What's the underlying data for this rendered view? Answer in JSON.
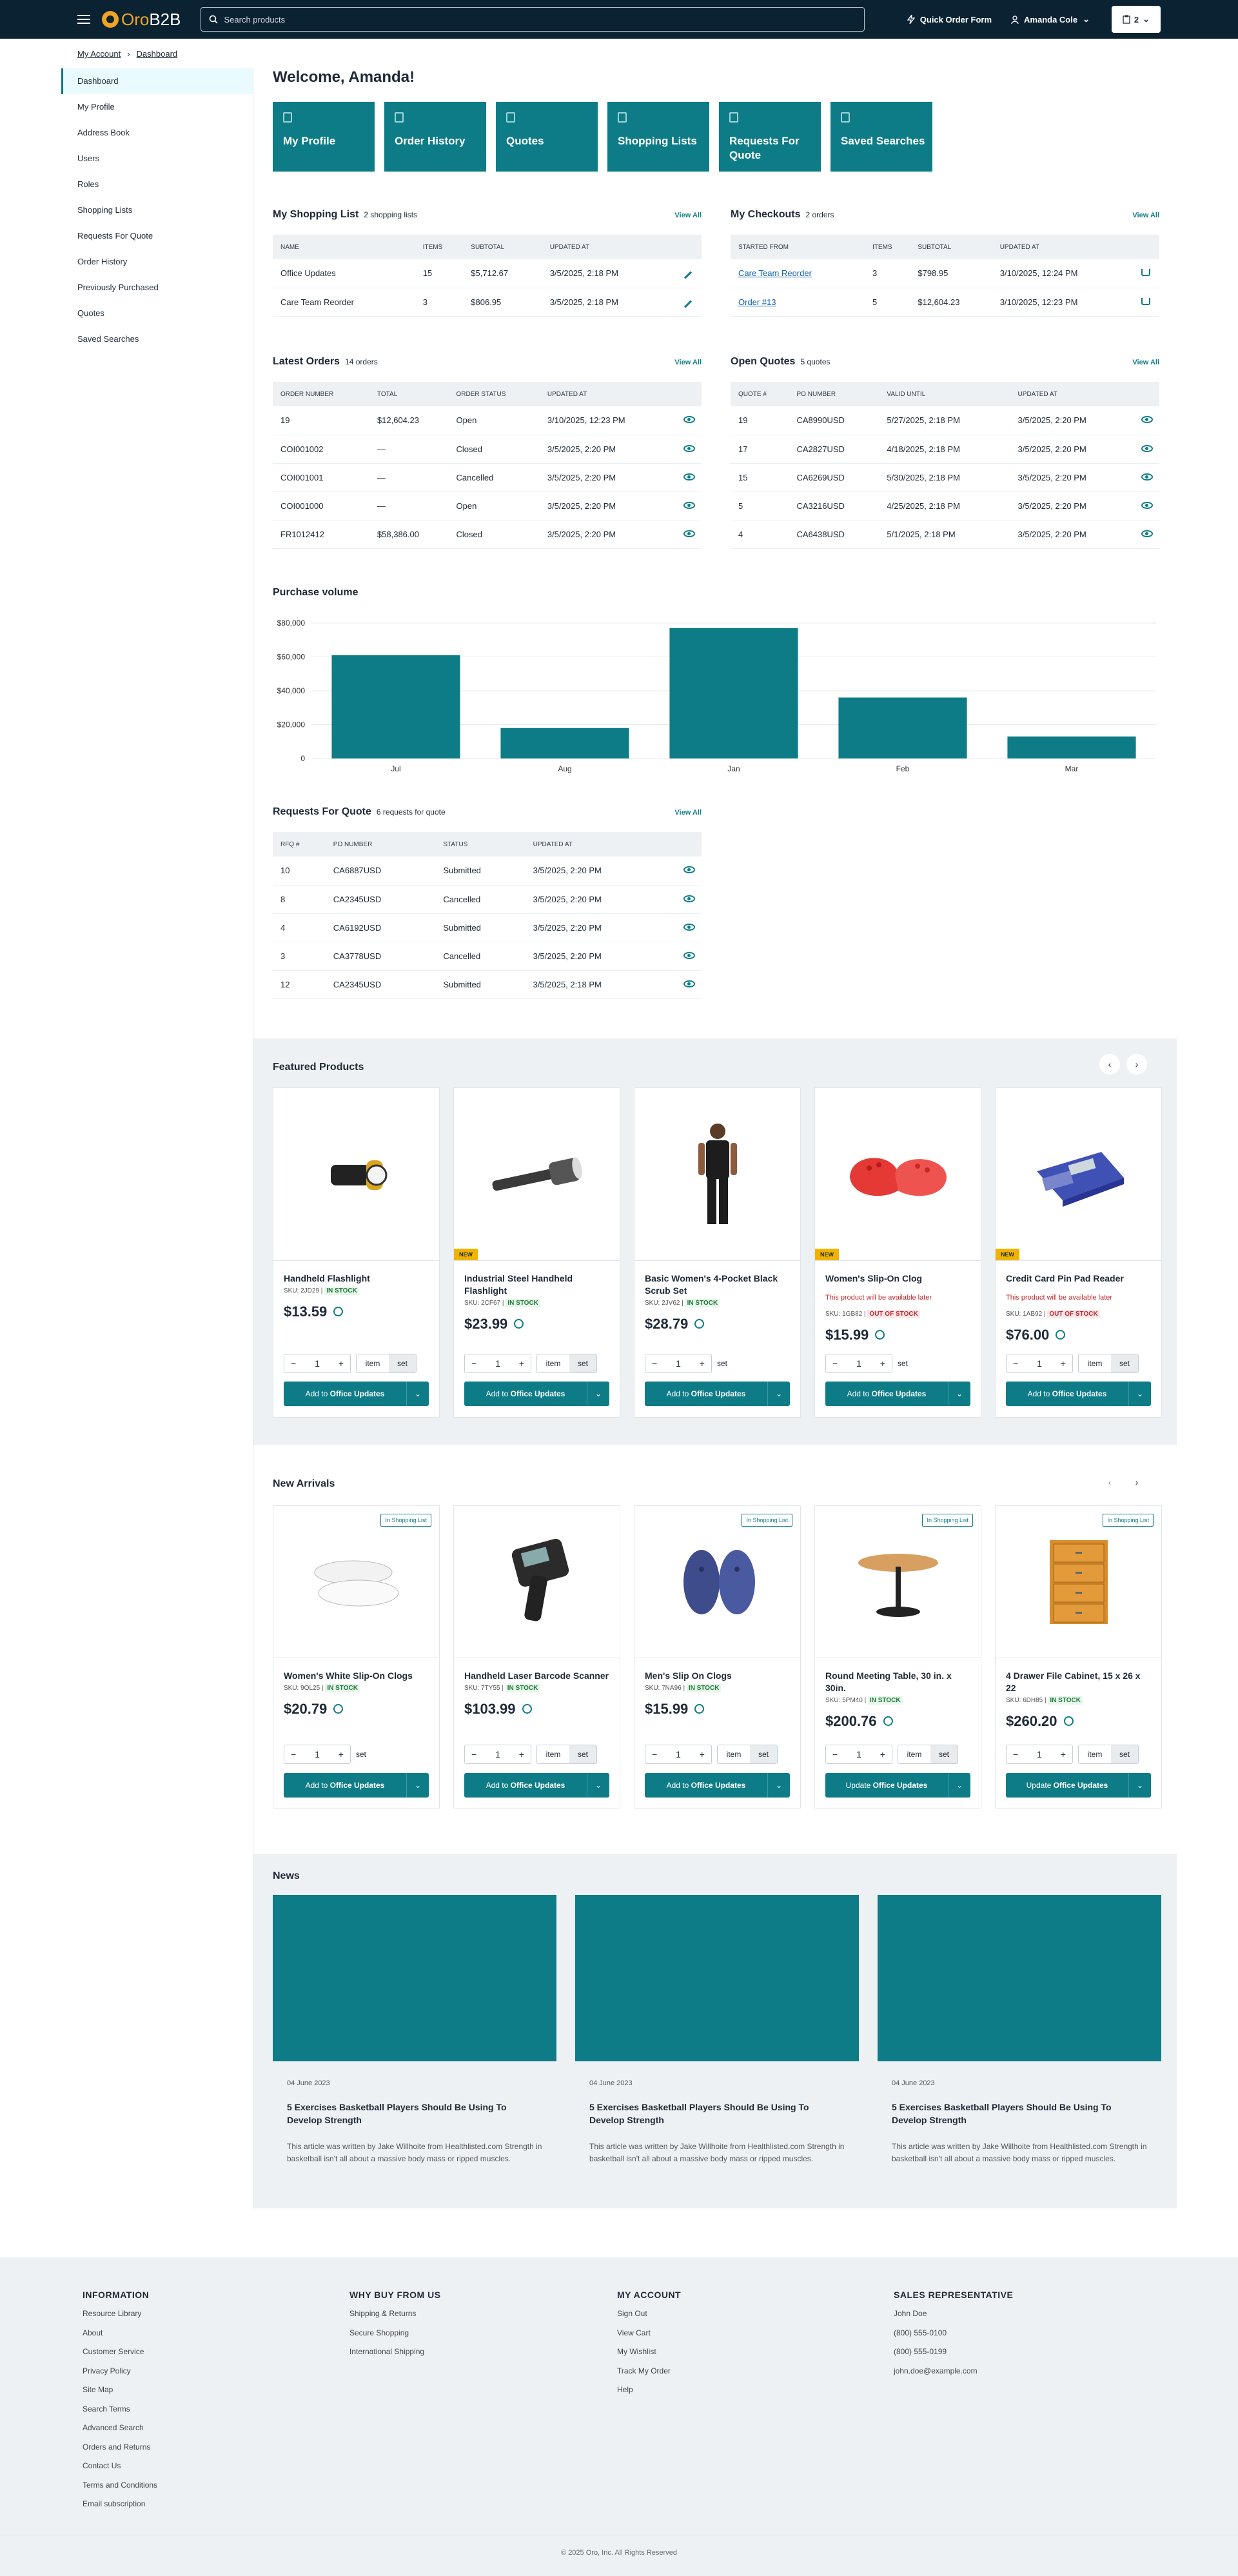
{
  "header": {
    "logo_oro": "Oro",
    "logo_b2b": "B2B",
    "search_placeholder": "Search products",
    "quick_order": "Quick Order Form",
    "user": "Amanda Cole",
    "cart_count": "2"
  },
  "breadcrumb": [
    "My Account",
    "Dashboard"
  ],
  "sidebar": {
    "items": [
      "Dashboard",
      "My Profile",
      "Address Book",
      "Users",
      "Roles",
      "Shopping Lists",
      "Requests For Quote",
      "Order History",
      "Previously Purchased",
      "Quotes",
      "Saved Searches"
    ]
  },
  "welcome": "Welcome, Amanda!",
  "tiles": [
    "My Profile",
    "Order History",
    "Quotes",
    "Shopping Lists",
    "Requests For Quote",
    "Saved Searches"
  ],
  "view_all": "View All",
  "shopping_list": {
    "title": "My Shopping List",
    "count": "2 shopping lists",
    "headers": [
      "NAME",
      "ITEMS",
      "SUBTOTAL",
      "UPDATED AT"
    ],
    "rows": [
      [
        "Office Updates",
        "15",
        "$5,712.67",
        "3/5/2025, 2:18 PM"
      ],
      [
        "Care Team Reorder",
        "3",
        "$806.95",
        "3/5/2025, 2:18 PM"
      ]
    ]
  },
  "checkouts": {
    "title": "My Checkouts",
    "count": "2 orders",
    "headers": [
      "STARTED FROM",
      "ITEMS",
      "SUBTOTAL",
      "UPDATED AT"
    ],
    "rows": [
      [
        "Care Team Reorder",
        "3",
        "$798.95",
        "3/10/2025, 12:24 PM"
      ],
      [
        "Order #13",
        "5",
        "$12,604.23",
        "3/10/2025, 12:23 PM"
      ]
    ]
  },
  "orders": {
    "title": "Latest Orders",
    "count": "14 orders",
    "headers": [
      "ORDER NUMBER",
      "TOTAL",
      "ORDER STATUS",
      "UPDATED AT"
    ],
    "rows": [
      [
        "19",
        "$12,604.23",
        "Open",
        "3/10/2025, 12:23 PM"
      ],
      [
        "COI001002",
        "—",
        "Closed",
        "3/5/2025, 2:20 PM"
      ],
      [
        "COI001001",
        "—",
        "Cancelled",
        "3/5/2025, 2:20 PM"
      ],
      [
        "COI001000",
        "—",
        "Open",
        "3/5/2025, 2:20 PM"
      ],
      [
        "FR1012412",
        "$58,386.00",
        "Closed",
        "3/5/2025, 2:20 PM"
      ]
    ]
  },
  "quotes": {
    "title": "Open Quotes",
    "count": "5 quotes",
    "headers": [
      "QUOTE #",
      "PO NUMBER",
      "VALID UNTIL",
      "UPDATED AT"
    ],
    "rows": [
      [
        "19",
        "CA8990USD",
        "5/27/2025, 2:18 PM",
        "3/5/2025, 2:20 PM"
      ],
      [
        "17",
        "CA2827USD",
        "4/18/2025, 2:18 PM",
        "3/5/2025, 2:20 PM"
      ],
      [
        "15",
        "CA6269USD",
        "5/30/2025, 2:18 PM",
        "3/5/2025, 2:20 PM"
      ],
      [
        "5",
        "CA3216USD",
        "4/25/2025, 2:18 PM",
        "3/5/2025, 2:20 PM"
      ],
      [
        "4",
        "CA6438USD",
        "5/1/2025, 2:18 PM",
        "3/5/2025, 2:20 PM"
      ]
    ]
  },
  "chart_data": {
    "type": "bar",
    "title": "Purchase volume",
    "categories": [
      "Jul",
      "Aug",
      "Jan",
      "Feb",
      "Mar"
    ],
    "values": [
      61000,
      18000,
      77000,
      36000,
      13000
    ],
    "ylim": [
      0,
      80000
    ],
    "yticks": [
      "$80,000",
      "$60,000",
      "$40,000",
      "$20,000",
      "0"
    ],
    "color": "#0e7c86",
    "grid": true
  },
  "rfq": {
    "title": "Requests For Quote",
    "count": "6 requests for quote",
    "headers": [
      "RFQ #",
      "PO NUMBER",
      "STATUS",
      "UPDATED AT"
    ],
    "rows": [
      [
        "10",
        "CA6887USD",
        "Submitted",
        "3/5/2025, 2:20 PM"
      ],
      [
        "8",
        "CA2345USD",
        "Cancelled",
        "3/5/2025, 2:20 PM"
      ],
      [
        "4",
        "CA6192USD",
        "Submitted",
        "3/5/2025, 2:20 PM"
      ],
      [
        "3",
        "CA3778USD",
        "Cancelled",
        "3/5/2025, 2:20 PM"
      ],
      [
        "12",
        "CA2345USD",
        "Submitted",
        "3/5/2025, 2:18 PM"
      ]
    ]
  },
  "featured": {
    "title": "Featured Products",
    "products": [
      {
        "name": "Handheld Flashlight",
        "sku": "SKU: 2JD29 |",
        "stock": "IN STOCK",
        "price": "$13.59",
        "new": "",
        "avail": "",
        "unit": "item",
        "set": "set",
        "btn_prefix": "Add to",
        "btn_list": "Office Updates"
      },
      {
        "name": "Industrial Steel Handheld Flashlight",
        "sku": "SKU: 2CF67 |",
        "stock": "IN STOCK",
        "price": "$23.99",
        "new": "NEW",
        "avail": "",
        "unit": "item",
        "set": "set",
        "btn_prefix": "Add to",
        "btn_list": "Office Updates"
      },
      {
        "name": "Basic Women's 4-Pocket Black Scrub Set",
        "sku": "SKU: 2JV62 |",
        "stock": "IN STOCK",
        "price": "$28.79",
        "new": "",
        "avail": "",
        "unit": "",
        "set": "set",
        "btn_prefix": "Add to",
        "btn_list": "Office Updates"
      },
      {
        "name": "Women's Slip-On Clog",
        "sku": "SKU: 1GB82 |",
        "stock": "OUT OF STOCK",
        "price": "$15.99",
        "new": "NEW",
        "avail": "This product will be available later",
        "unit": "",
        "set": "set",
        "btn_prefix": "Add to",
        "btn_list": "Office Updates"
      },
      {
        "name": "Credit Card Pin Pad Reader",
        "sku": "SKU: 1AB92 |",
        "stock": "OUT OF STOCK",
        "price": "$76.00",
        "new": "NEW",
        "avail": "This product will be available later",
        "unit": "item",
        "set": "set",
        "btn_prefix": "Add to",
        "btn_list": "Office Updates"
      }
    ]
  },
  "arrivals": {
    "title": "New Arrivals",
    "in_list": "In Shopping List",
    "products": [
      {
        "name": "Women's White Slip-On Clogs",
        "sku": "SKU: 9OL25 |",
        "stock": "IN STOCK",
        "price": "$20.79",
        "unit": "",
        "set": "set",
        "btn_prefix": "Add to",
        "btn_list": "Office Updates"
      },
      {
        "name": "Handheld Laser Barcode Scanner",
        "sku": "SKU: 7TY55 |",
        "stock": "IN STOCK",
        "price": "$103.99",
        "unit": "item",
        "set": "set",
        "btn_prefix": "Add to",
        "btn_list": "Office Updates"
      },
      {
        "name": "Men's Slip On Clogs",
        "sku": "SKU: 7NA96 |",
        "stock": "IN STOCK",
        "price": "$15.99",
        "unit": "item",
        "set": "set",
        "btn_prefix": "Add to",
        "btn_list": "Office Updates"
      },
      {
        "name": "Round Meeting Table, 30 in. x 30in.",
        "sku": "SKU: 5PM40 |",
        "stock": "IN STOCK",
        "price": "$200.76",
        "unit": "item",
        "set": "set",
        "btn_prefix": "Update",
        "btn_list": "Office Updates"
      },
      {
        "name": "4 Drawer File Cabinet, 15 x 26 x 22",
        "sku": "SKU: 6DH85 |",
        "stock": "IN STOCK",
        "price": "$260.20",
        "unit": "item",
        "set": "set",
        "btn_prefix": "Update",
        "btn_list": "Office Updates"
      }
    ]
  },
  "news": {
    "title": "News",
    "items": [
      {
        "date": "04 June 2023",
        "title": "5 Exercises Basketball Players Should Be Using To Develop Strength",
        "desc": "This article was written by Jake Willhoite from Healthlisted.com Strength in basketball isn't all about a massive body mass or ripped muscles."
      },
      {
        "date": "04 June 2023",
        "title": "5 Exercises Basketball Players Should Be Using To Develop Strength",
        "desc": "This article was written by Jake Willhoite from Healthlisted.com Strength in basketball isn't all about a massive body mass or ripped muscles."
      },
      {
        "date": "04 June 2023",
        "title": "5 Exercises Basketball Players Should Be Using To Develop Strength",
        "desc": "This article was written by Jake Willhoite from Healthlisted.com Strength in basketball isn't all about a massive body mass or ripped muscles."
      }
    ]
  },
  "footer": {
    "cols": [
      {
        "title": "INFORMATION",
        "links": [
          "Resource Library",
          "About",
          "Customer Service",
          "Privacy Policy",
          "Site Map",
          "Search Terms",
          "Advanced Search",
          "Orders and Returns",
          "Contact Us",
          "Terms and Conditions",
          "Email subscription"
        ]
      },
      {
        "title": "WHY BUY FROM US",
        "links": [
          "Shipping & Returns",
          "Secure Shopping",
          "International Shipping"
        ]
      },
      {
        "title": "MY ACCOUNT",
        "links": [
          "Sign Out",
          "View Cart",
          "My Wishlist",
          "Track My Order",
          "Help"
        ]
      },
      {
        "title": "SALES REPRESENTATIVE",
        "links": [
          "John Doe",
          "(800) 555-0100",
          "(800) 555-0199",
          "john.doe@example.com"
        ]
      }
    ],
    "copyright": "© 2025 Oro, Inc. All Rights Reserved"
  }
}
